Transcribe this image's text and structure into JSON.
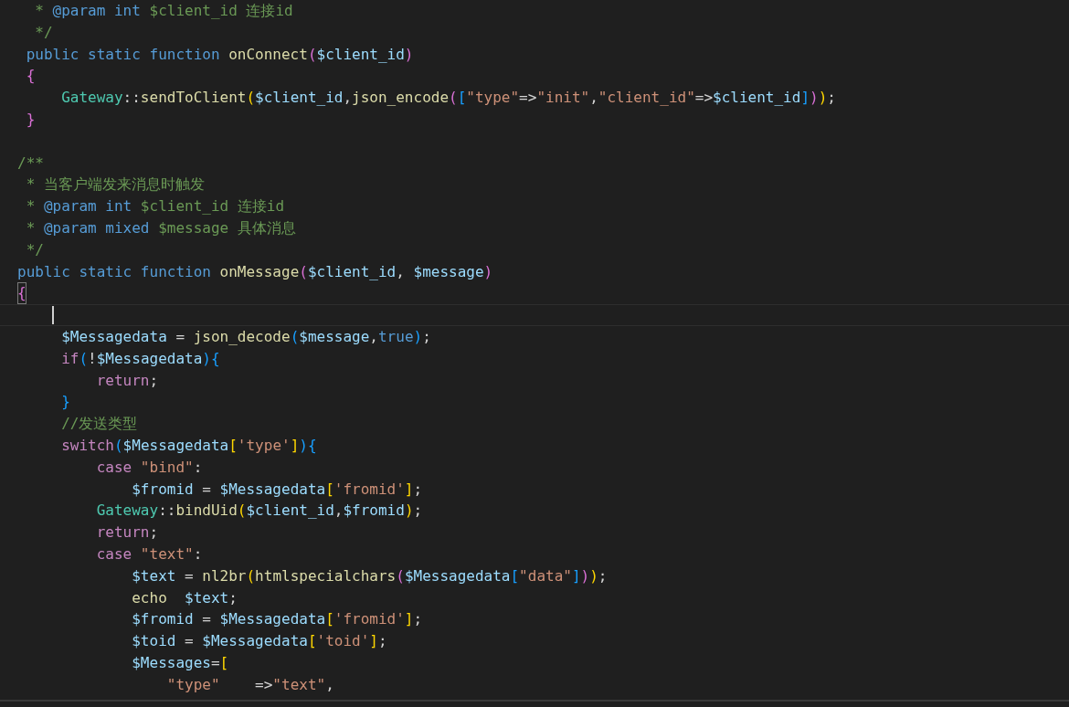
{
  "editor": {
    "lines": [
      {
        "current": false,
        "tokens": [
          {
            "kind": "comment",
            "text": "  * "
          },
          {
            "kind": "keyword",
            "text": "@param"
          },
          {
            "kind": "keyword",
            "text": " int"
          },
          {
            "kind": "comment",
            "text": " $client_id 连接id"
          }
        ]
      },
      {
        "current": false,
        "tokens": [
          {
            "kind": "comment",
            "text": "  */"
          }
        ]
      },
      {
        "current": false,
        "tokens": [
          {
            "kind": "keyword",
            "text": " public static function "
          },
          {
            "kind": "func",
            "text": "onConnect"
          },
          {
            "kind": "bracket2",
            "text": "("
          },
          {
            "kind": "var",
            "text": "$client_id"
          },
          {
            "kind": "bracket2",
            "text": ")"
          }
        ]
      },
      {
        "current": false,
        "tokens": [
          {
            "kind": "bracket2",
            "text": " {"
          }
        ]
      },
      {
        "current": false,
        "tokens": [
          {
            "kind": "class",
            "text": "     Gateway"
          },
          {
            "kind": "plain",
            "text": "::"
          },
          {
            "kind": "func",
            "text": "sendToClient"
          },
          {
            "kind": "bracket1",
            "text": "("
          },
          {
            "kind": "var",
            "text": "$client_id"
          },
          {
            "kind": "plain",
            "text": ","
          },
          {
            "kind": "func",
            "text": "json_encode"
          },
          {
            "kind": "bracket2",
            "text": "("
          },
          {
            "kind": "bracket3",
            "text": "["
          },
          {
            "kind": "string",
            "text": "\"type\""
          },
          {
            "kind": "plain",
            "text": "=>"
          },
          {
            "kind": "string",
            "text": "\"init\""
          },
          {
            "kind": "plain",
            "text": ","
          },
          {
            "kind": "string",
            "text": "\"client_id\""
          },
          {
            "kind": "plain",
            "text": "=>"
          },
          {
            "kind": "var",
            "text": "$client_id"
          },
          {
            "kind": "bracket3",
            "text": "]"
          },
          {
            "kind": "bracket2",
            "text": ")"
          },
          {
            "kind": "bracket1",
            "text": ")"
          },
          {
            "kind": "plain",
            "text": ";"
          }
        ]
      },
      {
        "current": false,
        "tokens": [
          {
            "kind": "bracket2",
            "text": " }"
          }
        ]
      },
      {
        "current": false
      },
      {
        "current": false,
        "tokens": [
          {
            "kind": "comment",
            "text": "/**"
          }
        ]
      },
      {
        "current": false,
        "tokens": [
          {
            "kind": "comment",
            "text": " * 当客户端发来消息时触发"
          }
        ]
      },
      {
        "current": false,
        "tokens": [
          {
            "kind": "comment",
            "text": " * "
          },
          {
            "kind": "keyword",
            "text": "@param"
          },
          {
            "kind": "keyword",
            "text": " int"
          },
          {
            "kind": "comment",
            "text": " $client_id 连接id"
          }
        ]
      },
      {
        "current": false,
        "tokens": [
          {
            "kind": "comment",
            "text": " * "
          },
          {
            "kind": "keyword",
            "text": "@param"
          },
          {
            "kind": "keyword",
            "text": " mixed"
          },
          {
            "kind": "comment",
            "text": " $message 具体消息"
          }
        ]
      },
      {
        "current": false,
        "tokens": [
          {
            "kind": "comment",
            "text": " */"
          }
        ]
      },
      {
        "current": false,
        "tokens": [
          {
            "kind": "keyword",
            "text": "public static function "
          },
          {
            "kind": "func",
            "text": "onMessage"
          },
          {
            "kind": "bracket2",
            "text": "("
          },
          {
            "kind": "var",
            "text": "$client_id"
          },
          {
            "kind": "plain",
            "text": ", "
          },
          {
            "kind": "var",
            "text": "$message"
          },
          {
            "kind": "bracket2",
            "text": ")"
          }
        ]
      },
      {
        "current": false,
        "tokens": [
          {
            "kind": "bracket_match",
            "text": "{"
          }
        ]
      },
      {
        "current": true
      },
      {
        "current": false,
        "tokens": [
          {
            "kind": "var",
            "text": "     $Messagedata"
          },
          {
            "kind": "plain",
            "text": " = "
          },
          {
            "kind": "func",
            "text": "json_decode"
          },
          {
            "kind": "bracket3",
            "text": "("
          },
          {
            "kind": "var",
            "text": "$message"
          },
          {
            "kind": "plain",
            "text": ","
          },
          {
            "kind": "keyword",
            "text": "true"
          },
          {
            "kind": "bracket3",
            "text": ")"
          },
          {
            "kind": "plain",
            "text": ";"
          }
        ]
      },
      {
        "current": false,
        "tokens": [
          {
            "kind": "control",
            "text": "     if"
          },
          {
            "kind": "bracket3",
            "text": "("
          },
          {
            "kind": "plain",
            "text": "!"
          },
          {
            "kind": "var",
            "text": "$Messagedata"
          },
          {
            "kind": "bracket3",
            "text": ")"
          },
          {
            "kind": "bracket3",
            "text": "{"
          }
        ]
      },
      {
        "current": false,
        "tokens": [
          {
            "kind": "control",
            "text": "         return"
          },
          {
            "kind": "plain",
            "text": ";"
          }
        ]
      },
      {
        "current": false,
        "tokens": [
          {
            "kind": "bracket3",
            "text": "     }"
          }
        ]
      },
      {
        "current": false,
        "tokens": [
          {
            "kind": "comment",
            "text": "     //发送类型"
          }
        ]
      },
      {
        "current": false,
        "tokens": [
          {
            "kind": "control",
            "text": "     switch"
          },
          {
            "kind": "bracket3",
            "text": "("
          },
          {
            "kind": "var",
            "text": "$Messagedata"
          },
          {
            "kind": "bracket1",
            "text": "["
          },
          {
            "kind": "string",
            "text": "'type'"
          },
          {
            "kind": "bracket1",
            "text": "]"
          },
          {
            "kind": "bracket3",
            "text": ")"
          },
          {
            "kind": "bracket3",
            "text": "{"
          }
        ]
      },
      {
        "current": false,
        "tokens": [
          {
            "kind": "control",
            "text": "         case "
          },
          {
            "kind": "string",
            "text": "\"bind\""
          },
          {
            "kind": "plain",
            "text": ":"
          }
        ]
      },
      {
        "current": false,
        "tokens": [
          {
            "kind": "var",
            "text": "             $fromid"
          },
          {
            "kind": "plain",
            "text": " = "
          },
          {
            "kind": "var",
            "text": "$Messagedata"
          },
          {
            "kind": "bracket1",
            "text": "["
          },
          {
            "kind": "string",
            "text": "'fromid'"
          },
          {
            "kind": "bracket1",
            "text": "]"
          },
          {
            "kind": "plain",
            "text": ";"
          }
        ]
      },
      {
        "current": false,
        "tokens": [
          {
            "kind": "class",
            "text": "         Gateway"
          },
          {
            "kind": "plain",
            "text": "::"
          },
          {
            "kind": "func",
            "text": "bindUid"
          },
          {
            "kind": "bracket1",
            "text": "("
          },
          {
            "kind": "var",
            "text": "$client_id"
          },
          {
            "kind": "plain",
            "text": ","
          },
          {
            "kind": "var",
            "text": "$fromid"
          },
          {
            "kind": "bracket1",
            "text": ")"
          },
          {
            "kind": "plain",
            "text": ";"
          }
        ]
      },
      {
        "current": false,
        "tokens": [
          {
            "kind": "control",
            "text": "         return"
          },
          {
            "kind": "plain",
            "text": ";"
          }
        ]
      },
      {
        "current": false,
        "tokens": [
          {
            "kind": "control",
            "text": "         case "
          },
          {
            "kind": "string",
            "text": "\"text\""
          },
          {
            "kind": "plain",
            "text": ":"
          }
        ]
      },
      {
        "current": false,
        "tokens": [
          {
            "kind": "var",
            "text": "             $text"
          },
          {
            "kind": "plain",
            "text": " = "
          },
          {
            "kind": "func",
            "text": "nl2br"
          },
          {
            "kind": "bracket1",
            "text": "("
          },
          {
            "kind": "func",
            "text": "htmlspecialchars"
          },
          {
            "kind": "bracket2",
            "text": "("
          },
          {
            "kind": "var",
            "text": "$Messagedata"
          },
          {
            "kind": "bracket3",
            "text": "["
          },
          {
            "kind": "string",
            "text": "\"data\""
          },
          {
            "kind": "bracket3",
            "text": "]"
          },
          {
            "kind": "bracket2",
            "text": ")"
          },
          {
            "kind": "bracket1",
            "text": ")"
          },
          {
            "kind": "plain",
            "text": ";"
          }
        ]
      },
      {
        "current": false,
        "tokens": [
          {
            "kind": "func",
            "text": "             echo  "
          },
          {
            "kind": "var",
            "text": "$text"
          },
          {
            "kind": "plain",
            "text": ";"
          }
        ]
      },
      {
        "current": false,
        "tokens": [
          {
            "kind": "var",
            "text": "             $fromid"
          },
          {
            "kind": "plain",
            "text": " = "
          },
          {
            "kind": "var",
            "text": "$Messagedata"
          },
          {
            "kind": "bracket1",
            "text": "["
          },
          {
            "kind": "string",
            "text": "'fromid'"
          },
          {
            "kind": "bracket1",
            "text": "]"
          },
          {
            "kind": "plain",
            "text": ";"
          }
        ]
      },
      {
        "current": false,
        "tokens": [
          {
            "kind": "var",
            "text": "             $toid"
          },
          {
            "kind": "plain",
            "text": " = "
          },
          {
            "kind": "var",
            "text": "$Messagedata"
          },
          {
            "kind": "bracket1",
            "text": "["
          },
          {
            "kind": "string",
            "text": "'toid'"
          },
          {
            "kind": "bracket1",
            "text": "]"
          },
          {
            "kind": "plain",
            "text": ";"
          }
        ]
      },
      {
        "current": false,
        "tokens": [
          {
            "kind": "var",
            "text": "             $Messages"
          },
          {
            "kind": "plain",
            "text": "="
          },
          {
            "kind": "bracket1",
            "text": "["
          }
        ]
      },
      {
        "current": false,
        "tokens": [
          {
            "kind": "string",
            "text": "                 \"type\""
          },
          {
            "kind": "plain",
            "text": "    =>"
          },
          {
            "kind": "string",
            "text": "\"text\""
          },
          {
            "kind": "plain",
            "text": ","
          }
        ]
      }
    ]
  }
}
